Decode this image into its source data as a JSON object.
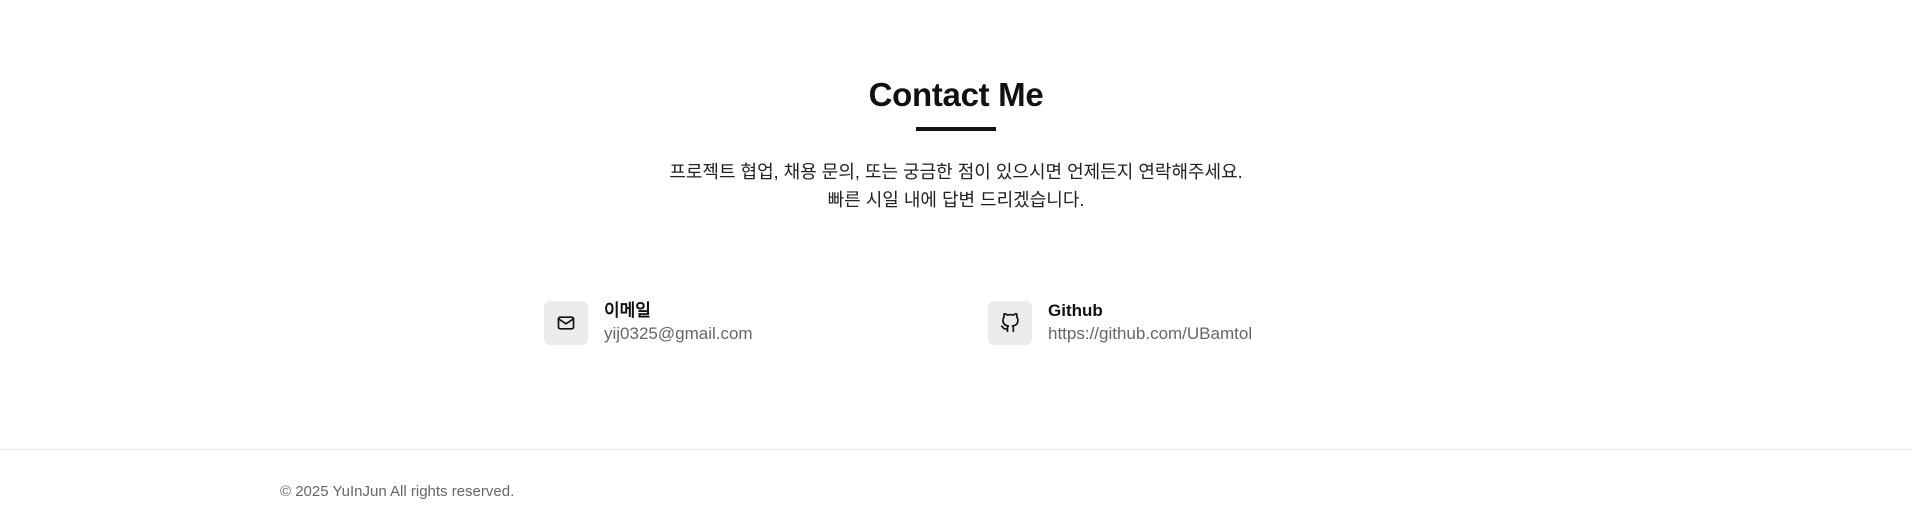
{
  "contact": {
    "title": "Contact Me",
    "description_line1": "프로젝트 협업, 채용 문의, 또는 궁금한 점이 있으시면 언제든지 연락해주세요.",
    "description_line2": "빠른 시일 내에 답변 드리겠습니다.",
    "items": [
      {
        "icon": "mail-icon",
        "label": "이메일",
        "value": "yij0325@gmail.com"
      },
      {
        "icon": "github-icon",
        "label": "Github",
        "value": "https://github.com/UBamtol"
      }
    ]
  },
  "footer": {
    "copyright": "© 2025 YuInJun All rights reserved."
  },
  "colors": {
    "text": "#111111",
    "muted": "#666666",
    "icon_background": "#ebebeb",
    "divider": "#e5e5e5"
  }
}
